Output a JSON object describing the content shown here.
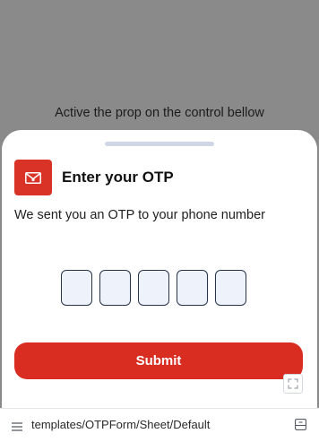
{
  "preview": {
    "hint_text": "Active the prop on the control bellow"
  },
  "sheet": {
    "icon": "envelope-icon",
    "title": "Enter your OTP",
    "subtitle": "We sent you an OTP to your phone number",
    "otp_values": [
      "",
      "",
      "",
      "",
      ""
    ],
    "submit_label": "Submit"
  },
  "toolbar": {
    "expand_icon": "fullscreen-icon",
    "menu_icon": "menu-icon",
    "story_path": "templates/OTPForm/Sheet/Default",
    "panel_icon": "panel-toggle-icon"
  },
  "colors": {
    "accent": "#da2d22",
    "backdrop": "#8a8a8a",
    "otp_box_fill": "#eef3fb",
    "otp_box_border": "#27344a"
  }
}
